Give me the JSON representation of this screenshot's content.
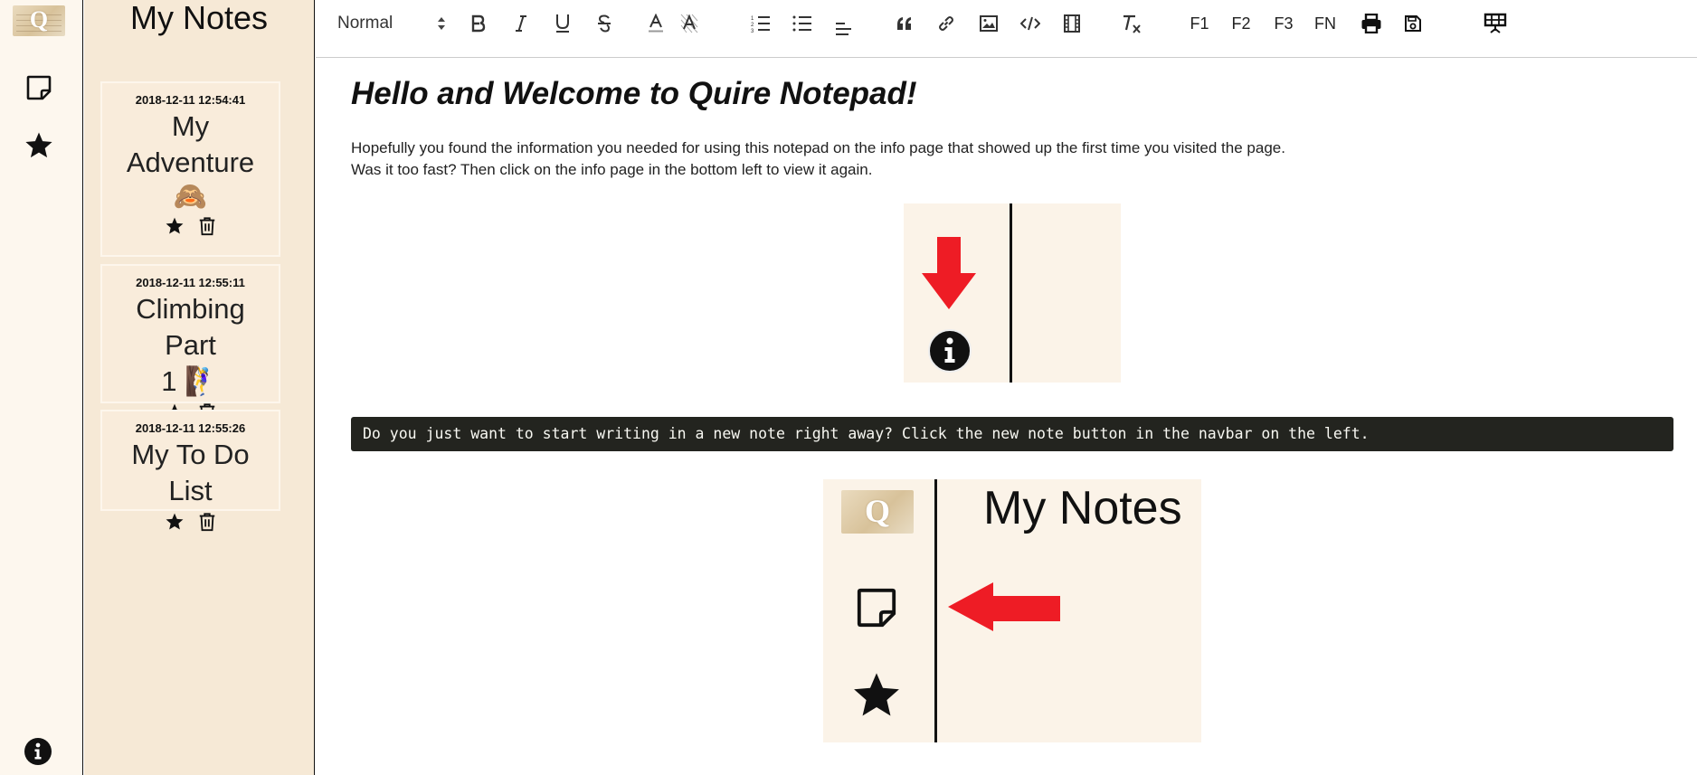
{
  "app": {
    "logo_letter": "Q"
  },
  "notes_panel": {
    "title": "My Notes",
    "cards": [
      {
        "date": "2018-12-11 12:54:41",
        "title_line1": "My",
        "title_line2": "Adventure",
        "emoji": "🙈"
      },
      {
        "date": "2018-12-11 12:55:11",
        "title_line1": "Climbing Part",
        "title_line2": "1 🧗‍♀",
        "emoji": ""
      },
      {
        "date": "2018-12-11 12:55:26",
        "title_line1": "My To Do List",
        "title_line2": "",
        "emoji": ""
      }
    ]
  },
  "toolbar": {
    "format_select": "Normal",
    "f1": "F1",
    "f2": "F2",
    "f3": "F3",
    "fn": "FN"
  },
  "editor": {
    "heading": "Hello and Welcome to Quire Notepad!",
    "para1": "Hopefully you found the information you needed for using this notepad on the info page that showed up the first time you visited the page.",
    "para2": "Was it too fast? Then click on the info page in the bottom left to view it again.",
    "code": "Do you just want to start writing in a new note right away? Click the new note button in the navbar on the left.",
    "image2_title": "My Notes",
    "image2_logo_letter": "Q"
  },
  "colors": {
    "rail_bg": "#fdf7ee",
    "notes_bg": "#f6e9d6",
    "card_bg": "#f9ecdb",
    "code_bg": "#23241f",
    "arrow_red": "#ee1c25"
  }
}
